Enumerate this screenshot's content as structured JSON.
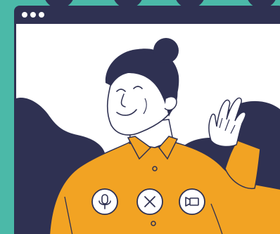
{
  "colors": {
    "teal_background": "#4bb9a8",
    "window_frame": "#2f3152",
    "window_canvas": "#ffffff",
    "silhouette": "#2f3152",
    "skin": "#ffffff",
    "hair": "#2f3152",
    "shirt": "#f2a323",
    "outline": "#2f3152",
    "control_button_fill": "#ffffff"
  },
  "window": {
    "titlebar_dots": 3
  },
  "controls": {
    "microphone": {
      "icon": "microphone-icon"
    },
    "end_call": {
      "icon": "close-icon"
    },
    "camera": {
      "icon": "video-camera-icon"
    }
  }
}
